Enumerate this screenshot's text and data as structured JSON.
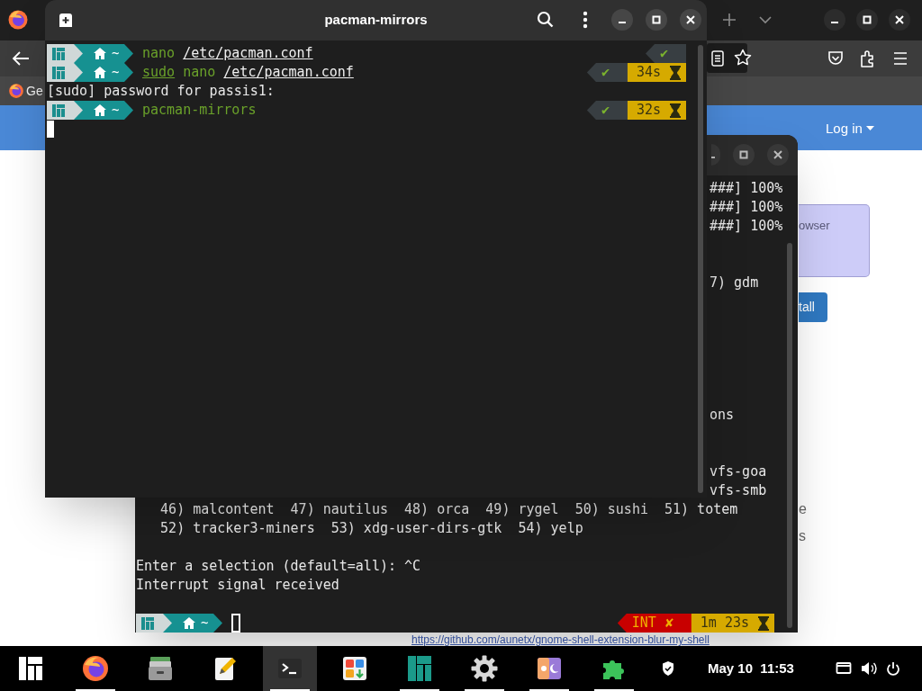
{
  "browser": {
    "tab_title": "Ge",
    "nav_link": "Log in",
    "notice_text": "owser",
    "install_button": "tall",
    "page_text": [
      "e",
      "s"
    ],
    "link": "https://github.com/aunetx/gnome-shell-extension-blur-my-shell"
  },
  "back_terminal": {
    "lines": [
      {
        "kind": "fragment",
        "text": "###] 100%"
      },
      {
        "kind": "fragment",
        "text": "###] 100%"
      },
      {
        "kind": "fragment",
        "text": "###] 100%"
      },
      {
        "kind": "fragment",
        "text": "7) gdm"
      },
      {
        "kind": "fragment",
        "text": "ons"
      },
      {
        "kind": "fragment",
        "text": "vfs-goa"
      },
      {
        "kind": "fragment",
        "text": "vfs-smb"
      },
      {
        "kind": "full",
        "text": "   46) malcontent  47) nautilus  48) orca  49) rygel  50) sushi  51) totem"
      },
      {
        "kind": "full",
        "text": "   52) tracker3-miners  53) xdg-user-dirs-gtk  54) yelp"
      },
      {
        "kind": "full",
        "text": "Enter a selection (default=all): ^C"
      },
      {
        "kind": "full",
        "text": "Interrupt signal received"
      }
    ],
    "prompt": {
      "path": "~",
      "status": {
        "kind": "error",
        "label": "INT",
        "symbol": "✘"
      },
      "duration": "1m 23s"
    }
  },
  "front_terminal": {
    "title": "pacman-mirrors",
    "lines": [
      {
        "kind": "prompt",
        "path": "~",
        "command": [
          {
            "text": "nano",
            "kind": "command",
            "underlined": false
          },
          {
            "text": "/etc/pacman.conf",
            "kind": "argument",
            "underlined": true
          }
        ],
        "status": {
          "kind": "ok",
          "symbol": "✔"
        }
      },
      {
        "kind": "prompt",
        "path": "~",
        "command": [
          {
            "text": "sudo",
            "kind": "command",
            "underlined": true
          },
          {
            "text": "nano",
            "kind": "command",
            "underlined": false
          },
          {
            "text": "/etc/pacman.conf",
            "kind": "argument",
            "underlined": true
          }
        ],
        "status": {
          "kind": "ok",
          "symbol": "✔"
        },
        "duration": "34s"
      },
      {
        "kind": "output",
        "text": "[sudo] password for passis1:"
      },
      {
        "kind": "prompt",
        "path": "~",
        "command": [
          {
            "text": "pacman-mirrors",
            "kind": "command",
            "underlined": false
          }
        ],
        "status": {
          "kind": "ok",
          "symbol": "✔"
        },
        "duration": "32s"
      }
    ]
  },
  "taskbar": {
    "apps": [
      {
        "kind": "menu",
        "active": false,
        "running": false
      },
      {
        "kind": "browser",
        "active": false,
        "running": true
      },
      {
        "kind": "files",
        "active": false,
        "running": false
      },
      {
        "kind": "editor",
        "active": false,
        "running": false
      },
      {
        "kind": "terminal",
        "active": true,
        "running": true
      },
      {
        "kind": "software",
        "active": false,
        "running": false
      },
      {
        "kind": "hello",
        "active": false,
        "running": true
      },
      {
        "kind": "settings",
        "active": false,
        "running": true
      },
      {
        "kind": "layout",
        "active": false,
        "running": true
      },
      {
        "kind": "extensions",
        "active": false,
        "running": true
      }
    ],
    "clock": "May 10  11:53"
  }
}
